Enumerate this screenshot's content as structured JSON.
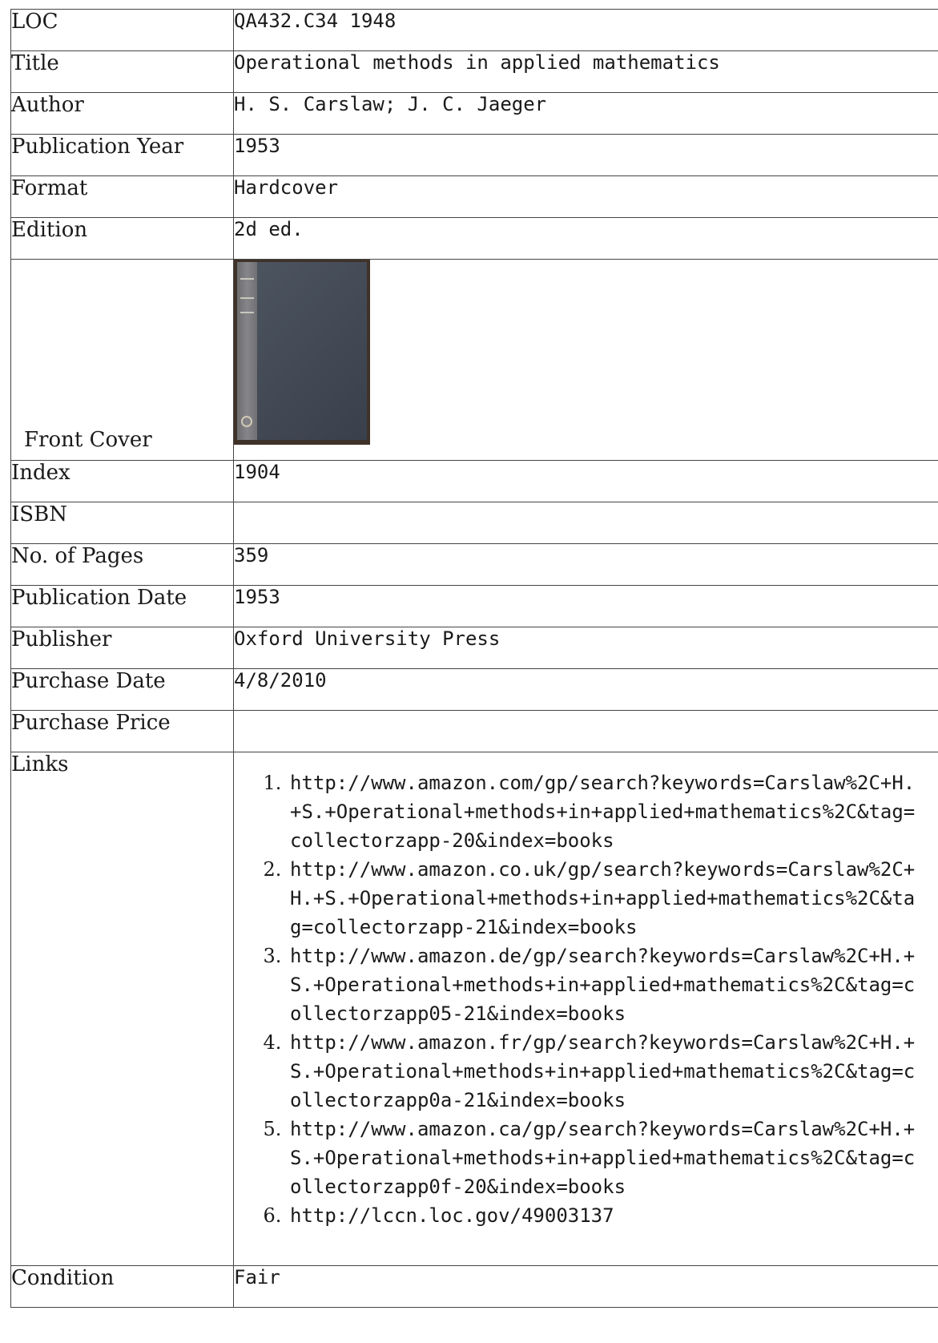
{
  "rows": [
    {
      "label": "LOC",
      "value": "QA432.C34 1948"
    },
    {
      "label": "Title",
      "value": "Operational methods in applied mathematics"
    },
    {
      "label": "Author",
      "value": "H. S. Carslaw; J. C. Jaeger"
    },
    {
      "label": "Publication Year",
      "value": "1953"
    },
    {
      "label": "Format",
      "value": "Hardcover"
    },
    {
      "label": "Edition",
      "value": "2d ed."
    }
  ],
  "cover": {
    "label": "Front Cover"
  },
  "rows2": [
    {
      "label": "Index",
      "value": "1904"
    },
    {
      "label": "ISBN",
      "value": ""
    },
    {
      "label": "No. of Pages",
      "value": "359"
    },
    {
      "label": "Publication Date",
      "value": "1953"
    },
    {
      "label": "Publisher",
      "value": "Oxford University Press"
    },
    {
      "label": "Purchase Date",
      "value": "4/8/2010"
    },
    {
      "label": "Purchase Price",
      "value": ""
    }
  ],
  "links": {
    "label": "Links",
    "items": [
      "http://www.amazon.com/gp/search?keywords=Carslaw%2C+H.+S.+Operational+methods+in+applied+mathematics%2C&tag=collectorzapp-20&index=books",
      "http://www.amazon.co.uk/gp/search?keywords=Carslaw%2C+H.+S.+Operational+methods+in+applied+mathematics%2C&tag=collectorzapp-21&index=books",
      "http://www.amazon.de/gp/search?keywords=Carslaw%2C+H.+S.+Operational+methods+in+applied+mathematics%2C&tag=collectorzapp05-21&index=books",
      "http://www.amazon.fr/gp/search?keywords=Carslaw%2C+H.+S.+Operational+methods+in+applied+mathematics%2C&tag=collectorzapp0a-21&index=books",
      "http://www.amazon.ca/gp/search?keywords=Carslaw%2C+H.+S.+Operational+methods+in+applied+mathematics%2C&tag=collectorzapp0f-20&index=books",
      "http://lccn.loc.gov/49003137"
    ]
  },
  "condition": {
    "label": "Condition",
    "value": "Fair"
  }
}
